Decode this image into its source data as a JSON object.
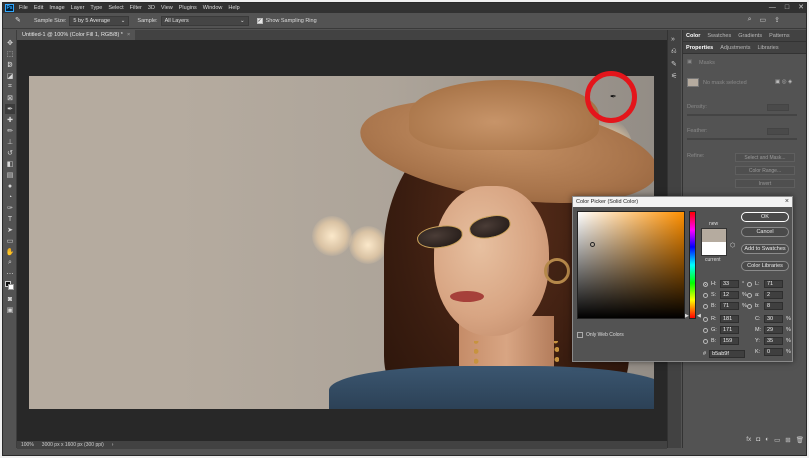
{
  "menubar": {
    "logo": "Ps",
    "items": [
      "File",
      "Edit",
      "Image",
      "Layer",
      "Type",
      "Select",
      "Filter",
      "3D",
      "View",
      "Plugins",
      "Window",
      "Help"
    ],
    "controls": [
      "—",
      "□",
      "✕"
    ]
  },
  "options": {
    "sample_size_label": "Sample Size:",
    "sample_size_value": "5 by 5 Average",
    "sample_label": "Sample:",
    "sample_value": "All Layers",
    "show_ring_label": "Show Sampling Ring",
    "show_ring_checked": "✓"
  },
  "document": {
    "tab_title": "Untitled-1 @ 100% (Color Fill 1, RGB/8) *",
    "close": "×"
  },
  "status": {
    "zoom": "100%",
    "size": "3000 px x 1600 px (300 ppi)"
  },
  "panels": {
    "top_tabs": [
      "Color",
      "Swatches",
      "Gradients",
      "Patterns"
    ],
    "sub_tabs": [
      "Properties",
      "Adjustments",
      "Libraries"
    ],
    "masks_label": "Masks",
    "no_mask": "No mask selected",
    "density_label": "Density:",
    "feather_label": "Feather:",
    "refine_label": "Refine:",
    "select_mask": "Select and Mask...",
    "color_range": "Color Range...",
    "invert": "Invert"
  },
  "color_picker": {
    "title": "Color Picker (Solid Color)",
    "new_label": "new",
    "current_label": "current",
    "ok": "OK",
    "cancel": "Cancel",
    "add_swatches": "Add to Swatches",
    "color_libraries": "Color Libraries",
    "only_web": "Only Web Colors",
    "new_color": "#b5ab9f",
    "current_color": "#ffffff",
    "hex_label": "#",
    "hex": "b5ab9f",
    "left_fields": [
      {
        "label": "H:",
        "value": "33",
        "unit": "°",
        "selected": true
      },
      {
        "label": "S:",
        "value": "12",
        "unit": "%",
        "selected": false
      },
      {
        "label": "B:",
        "value": "71",
        "unit": "%",
        "selected": false
      },
      {
        "label": "R:",
        "value": "181",
        "unit": "",
        "selected": false
      },
      {
        "label": "G:",
        "value": "171",
        "unit": "",
        "selected": false
      },
      {
        "label": "B:",
        "value": "159",
        "unit": "",
        "selected": false
      }
    ],
    "right_fields": [
      {
        "label": "L:",
        "value": "71",
        "unit": ""
      },
      {
        "label": "a:",
        "value": "2",
        "unit": ""
      },
      {
        "label": "b:",
        "value": "8",
        "unit": ""
      },
      {
        "label": "C:",
        "value": "30",
        "unit": "%"
      },
      {
        "label": "M:",
        "value": "29",
        "unit": "%"
      },
      {
        "label": "Y:",
        "value": "35",
        "unit": "%"
      },
      {
        "label": "K:",
        "value": "0",
        "unit": "%"
      }
    ]
  }
}
